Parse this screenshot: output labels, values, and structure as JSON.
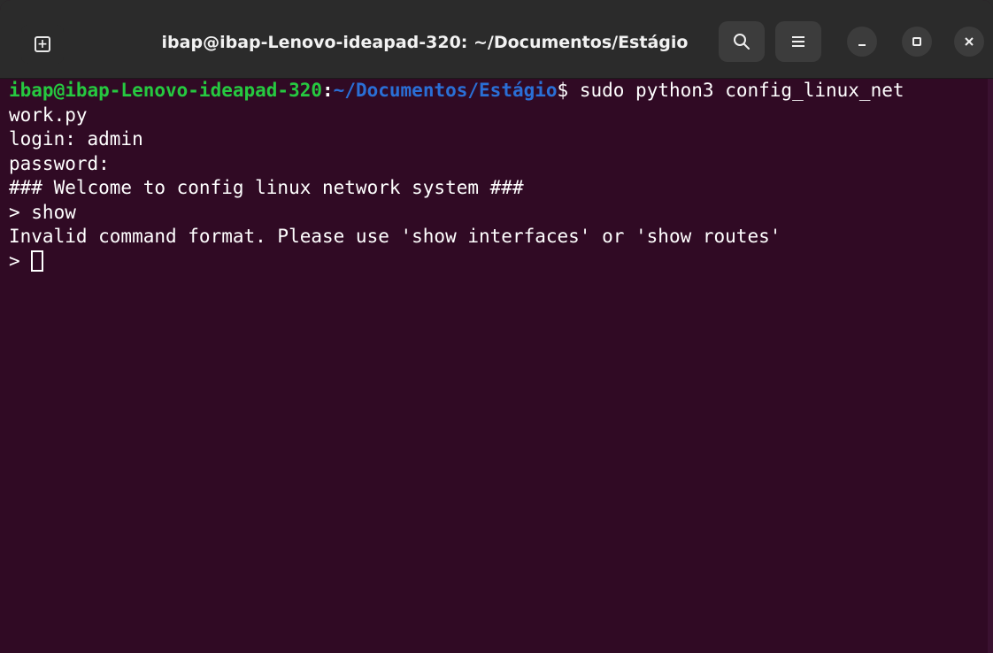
{
  "window": {
    "title": "ibap@ibap-Lenovo-ideapad-320: ~/Documentos/Estágio",
    "buttons": {
      "new_tab_icon": "new-tab-icon",
      "search_icon": "search-icon",
      "menu_icon": "hamburger-menu-icon",
      "minimize_label": "–",
      "maximize_label": "□",
      "close_label": "✕",
      "search_glyph": "⚲",
      "menu_glyph": "≡",
      "new_tab_glyph": "+"
    }
  },
  "terminal": {
    "prompt": {
      "user_host": "ibap@ibap-Lenovo-ideapad-320",
      "colon": ":",
      "path": "~/Documentos/Estágio",
      "dollar": "$",
      "command": " sudo python3 config_linux_net"
    },
    "lines": [
      "work.py",
      "login: admin",
      "password:",
      "### Welcome to config linux network system ###",
      "> show",
      "Invalid command format. Please use 'show interfaces' or 'show routes'"
    ],
    "current_prompt": "> "
  },
  "colors": {
    "background": "#300a24",
    "titlebar": "#2b2b2b",
    "prompt_user": "#26c940",
    "prompt_path": "#2a6fd6",
    "text": "#ffffff"
  }
}
